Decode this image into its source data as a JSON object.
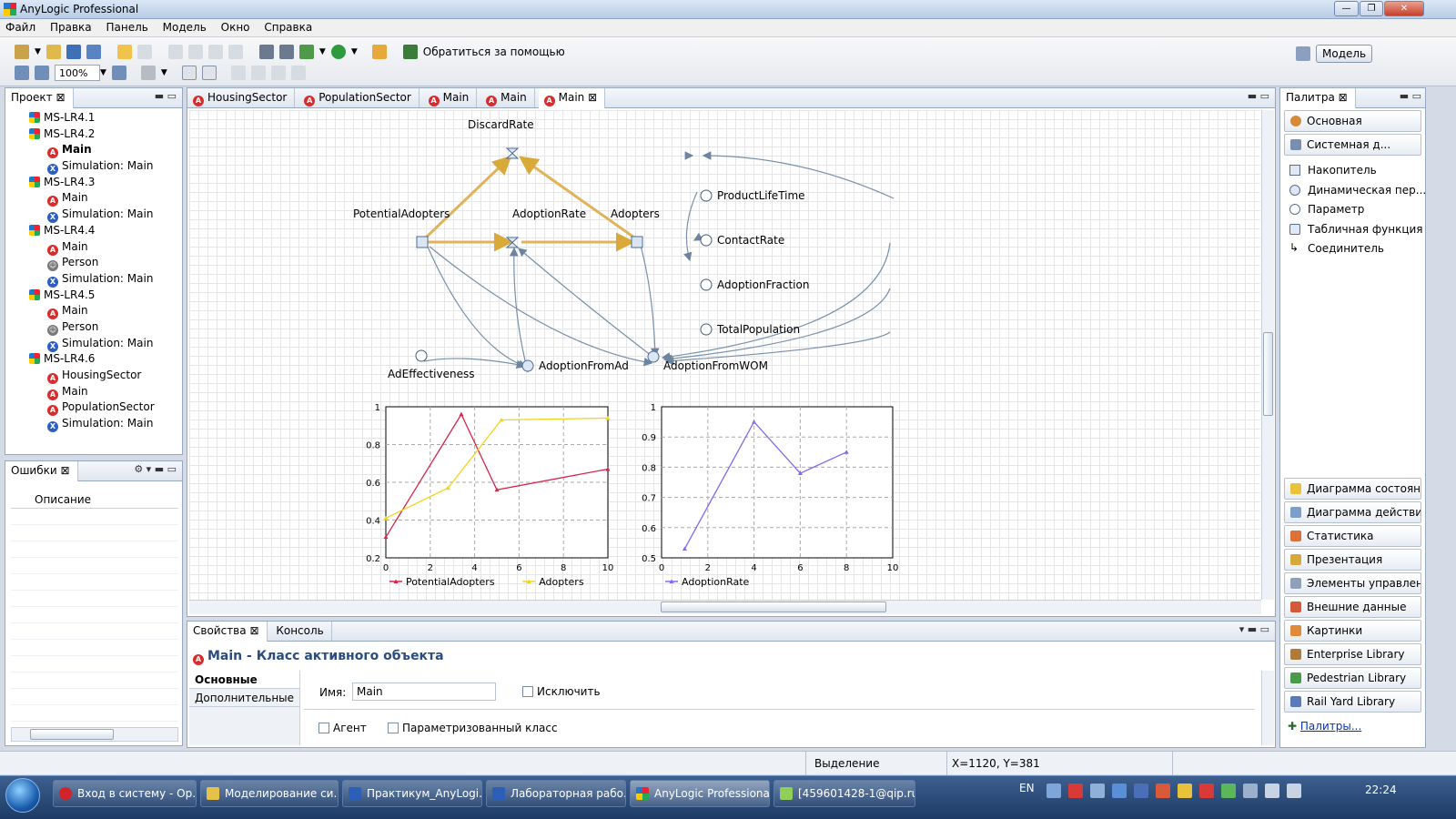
{
  "window": {
    "title": "AnyLogic Professional"
  },
  "menu": [
    "Файл",
    "Правка",
    "Панель",
    "Модель",
    "Окно",
    "Справка"
  ],
  "toolbar": {
    "zoom": "100%",
    "help_label": "Обратиться за помощью",
    "perspective": "Модель"
  },
  "project": {
    "tab": "Проект",
    "tree": [
      {
        "label": "MS-LR4.1",
        "type": "model",
        "level": 0
      },
      {
        "label": "MS-LR4.2",
        "type": "model",
        "level": 0
      },
      {
        "label": "Main",
        "type": "active",
        "level": 1,
        "bold": true
      },
      {
        "label": "Simulation: Main",
        "type": "sim",
        "level": 1
      },
      {
        "label": "MS-LR4.3",
        "type": "model",
        "level": 0
      },
      {
        "label": "Main",
        "type": "active",
        "level": 1
      },
      {
        "label": "Simulation: Main",
        "type": "sim",
        "level": 1
      },
      {
        "label": "MS-LR4.4",
        "type": "model",
        "level": 0
      },
      {
        "label": "Main",
        "type": "active",
        "level": 1
      },
      {
        "label": "Person",
        "type": "person",
        "level": 1
      },
      {
        "label": "Simulation: Main",
        "type": "sim",
        "level": 1
      },
      {
        "label": "MS-LR4.5",
        "type": "model",
        "level": 0
      },
      {
        "label": "Main",
        "type": "active",
        "level": 1
      },
      {
        "label": "Person",
        "type": "person",
        "level": 1
      },
      {
        "label": "Simulation: Main",
        "type": "sim",
        "level": 1
      },
      {
        "label": "MS-LR4.6",
        "type": "model",
        "level": 0
      },
      {
        "label": "HousingSector",
        "type": "active",
        "level": 1
      },
      {
        "label": "Main",
        "type": "active",
        "level": 1
      },
      {
        "label": "PopulationSector",
        "type": "active",
        "level": 1
      },
      {
        "label": "Simulation: Main",
        "type": "sim",
        "level": 1
      }
    ]
  },
  "errors": {
    "tab": "Ошибки",
    "column": "Описание"
  },
  "editor_tabs": [
    "HousingSector",
    "PopulationSector",
    "Main",
    "Main",
    "Main"
  ],
  "diagram": {
    "DiscardRate": "DiscardRate",
    "PotentialAdopters": "PotentialAdopters",
    "AdoptionRate": "AdoptionRate",
    "Adopters": "Adopters",
    "ProductLifeTime": "ProductLifeTime",
    "ContactRate": "ContactRate",
    "AdoptionFraction": "AdoptionFraction",
    "TotalPopulation": "TotalPopulation",
    "AdEffectiveness": "AdEffectiveness",
    "AdoptionFromAd": "AdoptionFromAd",
    "AdoptionFromWOM": "AdoptionFromWOM"
  },
  "chart_data": [
    {
      "type": "line",
      "xlim": [
        0,
        10
      ],
      "ylim": [
        0.2,
        1
      ],
      "xticks": [
        "0",
        "2",
        "4",
        "6",
        "8",
        "10"
      ],
      "yticks": [
        "0.2",
        "0.4",
        "0.6",
        "0.8",
        "1"
      ],
      "series": [
        {
          "name": "PotentialAdopters",
          "color": "#d8234a",
          "x": [
            0,
            3.4,
            5,
            10
          ],
          "y": [
            0.31,
            0.96,
            0.56,
            0.67
          ]
        },
        {
          "name": "Adopters",
          "color": "#f5d21b",
          "x": [
            0,
            2.8,
            5.2,
            10
          ],
          "y": [
            0.41,
            0.57,
            0.93,
            0.94
          ]
        }
      ]
    },
    {
      "type": "line",
      "xlim": [
        0,
        10
      ],
      "ylim": [
        0.5,
        1
      ],
      "xticks": [
        "0",
        "2",
        "4",
        "6",
        "8",
        "10"
      ],
      "yticks": [
        "0.5",
        "0.6",
        "0.7",
        "0.8",
        "0.9",
        "1"
      ],
      "series": [
        {
          "name": "AdoptionRate",
          "color": "#7b6cf0",
          "x": [
            1,
            4,
            6,
            8
          ],
          "y": [
            0.53,
            0.95,
            0.78,
            0.85
          ]
        }
      ]
    }
  ],
  "palette": {
    "tab": "Палитра",
    "sections_top": [
      "Основная",
      "Системная д..."
    ],
    "elements": [
      "Накопитель",
      "Динамическая пер...",
      "Параметр",
      "Табличная функция",
      "Соединитель"
    ],
    "sections_bottom": [
      "Диаграмма состоян...",
      "Диаграмма действий",
      "Статистика",
      "Презентация",
      "Элементы управлен...",
      "Внешние данные",
      "Картинки",
      "Enterprise Library",
      "Pedestrian Library",
      "Rail Yard Library"
    ],
    "link": "Палитры..."
  },
  "properties": {
    "tab": "Свойства",
    "console_tab": "Консоль",
    "heading": "Main - Класс активного объекта",
    "side_tabs": [
      "Основные",
      "Дополнительные"
    ],
    "name_label": "Имя:",
    "name_value": "Main",
    "exclude": "Исключить",
    "agent": "Агент",
    "parameterized": "Параметризованный класс"
  },
  "status": {
    "mode": "Выделение",
    "coords": "X=1120, Y=381"
  },
  "taskbar": {
    "items": [
      "Вход в систему - Ор...",
      "Моделирование си...",
      "Практикум_AnyLogi...",
      "Лабораторная рабо...",
      "AnyLogic Professional",
      "[459601428-1@qip.ru..."
    ],
    "lang": "EN",
    "clock": "22:24"
  }
}
